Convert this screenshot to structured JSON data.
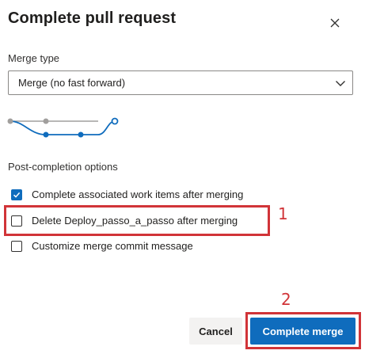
{
  "dialog": {
    "title": "Complete pull request",
    "close_icon": "close-icon"
  },
  "merge_type": {
    "label": "Merge type",
    "selected": "Merge (no fast forward)",
    "dropdown_icon": "chevron-down-icon",
    "graph_icon": "merge-graph-icon"
  },
  "post_completion": {
    "label": "Post-completion options",
    "options": [
      {
        "label": "Complete associated work items after merging",
        "checked": true
      },
      {
        "label": "Delete Deploy_passo_a_passo after merging",
        "checked": false
      },
      {
        "label": "Customize merge commit message",
        "checked": false
      }
    ]
  },
  "annotations": {
    "step1": "1",
    "step2": "2",
    "highlight_color": "#d13438"
  },
  "buttons": {
    "cancel": "Cancel",
    "complete": "Complete merge"
  },
  "colors": {
    "accent": "#0f6cbd",
    "graph_grey": "#a19f9d"
  }
}
